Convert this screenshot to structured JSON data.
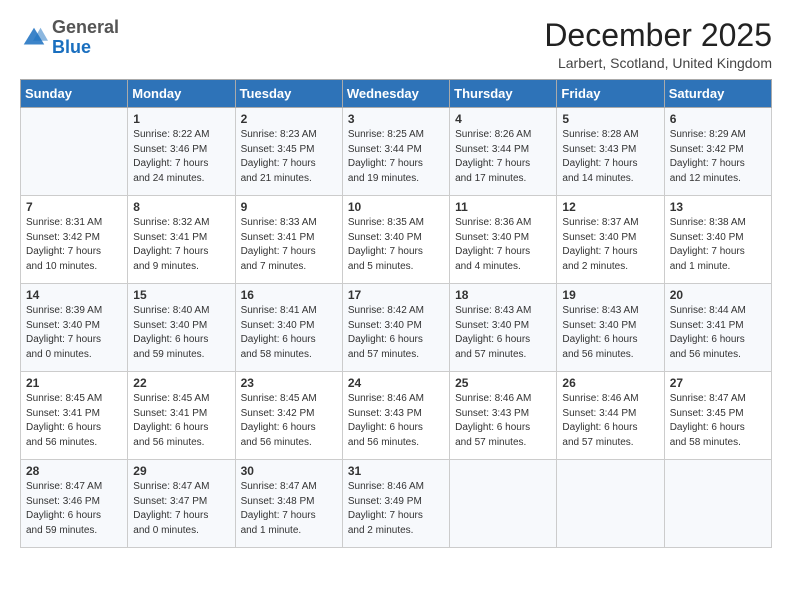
{
  "logo": {
    "general": "General",
    "blue": "Blue"
  },
  "title": "December 2025",
  "location": "Larbert, Scotland, United Kingdom",
  "days_of_week": [
    "Sunday",
    "Monday",
    "Tuesday",
    "Wednesday",
    "Thursday",
    "Friday",
    "Saturday"
  ],
  "weeks": [
    [
      {
        "day": "",
        "text": ""
      },
      {
        "day": "1",
        "text": "Sunrise: 8:22 AM\nSunset: 3:46 PM\nDaylight: 7 hours\nand 24 minutes."
      },
      {
        "day": "2",
        "text": "Sunrise: 8:23 AM\nSunset: 3:45 PM\nDaylight: 7 hours\nand 21 minutes."
      },
      {
        "day": "3",
        "text": "Sunrise: 8:25 AM\nSunset: 3:44 PM\nDaylight: 7 hours\nand 19 minutes."
      },
      {
        "day": "4",
        "text": "Sunrise: 8:26 AM\nSunset: 3:44 PM\nDaylight: 7 hours\nand 17 minutes."
      },
      {
        "day": "5",
        "text": "Sunrise: 8:28 AM\nSunset: 3:43 PM\nDaylight: 7 hours\nand 14 minutes."
      },
      {
        "day": "6",
        "text": "Sunrise: 8:29 AM\nSunset: 3:42 PM\nDaylight: 7 hours\nand 12 minutes."
      }
    ],
    [
      {
        "day": "7",
        "text": "Sunrise: 8:31 AM\nSunset: 3:42 PM\nDaylight: 7 hours\nand 10 minutes."
      },
      {
        "day": "8",
        "text": "Sunrise: 8:32 AM\nSunset: 3:41 PM\nDaylight: 7 hours\nand 9 minutes."
      },
      {
        "day": "9",
        "text": "Sunrise: 8:33 AM\nSunset: 3:41 PM\nDaylight: 7 hours\nand 7 minutes."
      },
      {
        "day": "10",
        "text": "Sunrise: 8:35 AM\nSunset: 3:40 PM\nDaylight: 7 hours\nand 5 minutes."
      },
      {
        "day": "11",
        "text": "Sunrise: 8:36 AM\nSunset: 3:40 PM\nDaylight: 7 hours\nand 4 minutes."
      },
      {
        "day": "12",
        "text": "Sunrise: 8:37 AM\nSunset: 3:40 PM\nDaylight: 7 hours\nand 2 minutes."
      },
      {
        "day": "13",
        "text": "Sunrise: 8:38 AM\nSunset: 3:40 PM\nDaylight: 7 hours\nand 1 minute."
      }
    ],
    [
      {
        "day": "14",
        "text": "Sunrise: 8:39 AM\nSunset: 3:40 PM\nDaylight: 7 hours\nand 0 minutes."
      },
      {
        "day": "15",
        "text": "Sunrise: 8:40 AM\nSunset: 3:40 PM\nDaylight: 6 hours\nand 59 minutes."
      },
      {
        "day": "16",
        "text": "Sunrise: 8:41 AM\nSunset: 3:40 PM\nDaylight: 6 hours\nand 58 minutes."
      },
      {
        "day": "17",
        "text": "Sunrise: 8:42 AM\nSunset: 3:40 PM\nDaylight: 6 hours\nand 57 minutes."
      },
      {
        "day": "18",
        "text": "Sunrise: 8:43 AM\nSunset: 3:40 PM\nDaylight: 6 hours\nand 57 minutes."
      },
      {
        "day": "19",
        "text": "Sunrise: 8:43 AM\nSunset: 3:40 PM\nDaylight: 6 hours\nand 56 minutes."
      },
      {
        "day": "20",
        "text": "Sunrise: 8:44 AM\nSunset: 3:41 PM\nDaylight: 6 hours\nand 56 minutes."
      }
    ],
    [
      {
        "day": "21",
        "text": "Sunrise: 8:45 AM\nSunset: 3:41 PM\nDaylight: 6 hours\nand 56 minutes."
      },
      {
        "day": "22",
        "text": "Sunrise: 8:45 AM\nSunset: 3:41 PM\nDaylight: 6 hours\nand 56 minutes."
      },
      {
        "day": "23",
        "text": "Sunrise: 8:45 AM\nSunset: 3:42 PM\nDaylight: 6 hours\nand 56 minutes."
      },
      {
        "day": "24",
        "text": "Sunrise: 8:46 AM\nSunset: 3:43 PM\nDaylight: 6 hours\nand 56 minutes."
      },
      {
        "day": "25",
        "text": "Sunrise: 8:46 AM\nSunset: 3:43 PM\nDaylight: 6 hours\nand 57 minutes."
      },
      {
        "day": "26",
        "text": "Sunrise: 8:46 AM\nSunset: 3:44 PM\nDaylight: 6 hours\nand 57 minutes."
      },
      {
        "day": "27",
        "text": "Sunrise: 8:47 AM\nSunset: 3:45 PM\nDaylight: 6 hours\nand 58 minutes."
      }
    ],
    [
      {
        "day": "28",
        "text": "Sunrise: 8:47 AM\nSunset: 3:46 PM\nDaylight: 6 hours\nand 59 minutes."
      },
      {
        "day": "29",
        "text": "Sunrise: 8:47 AM\nSunset: 3:47 PM\nDaylight: 7 hours\nand 0 minutes."
      },
      {
        "day": "30",
        "text": "Sunrise: 8:47 AM\nSunset: 3:48 PM\nDaylight: 7 hours\nand 1 minute."
      },
      {
        "day": "31",
        "text": "Sunrise: 8:46 AM\nSunset: 3:49 PM\nDaylight: 7 hours\nand 2 minutes."
      },
      {
        "day": "",
        "text": ""
      },
      {
        "day": "",
        "text": ""
      },
      {
        "day": "",
        "text": ""
      }
    ]
  ]
}
